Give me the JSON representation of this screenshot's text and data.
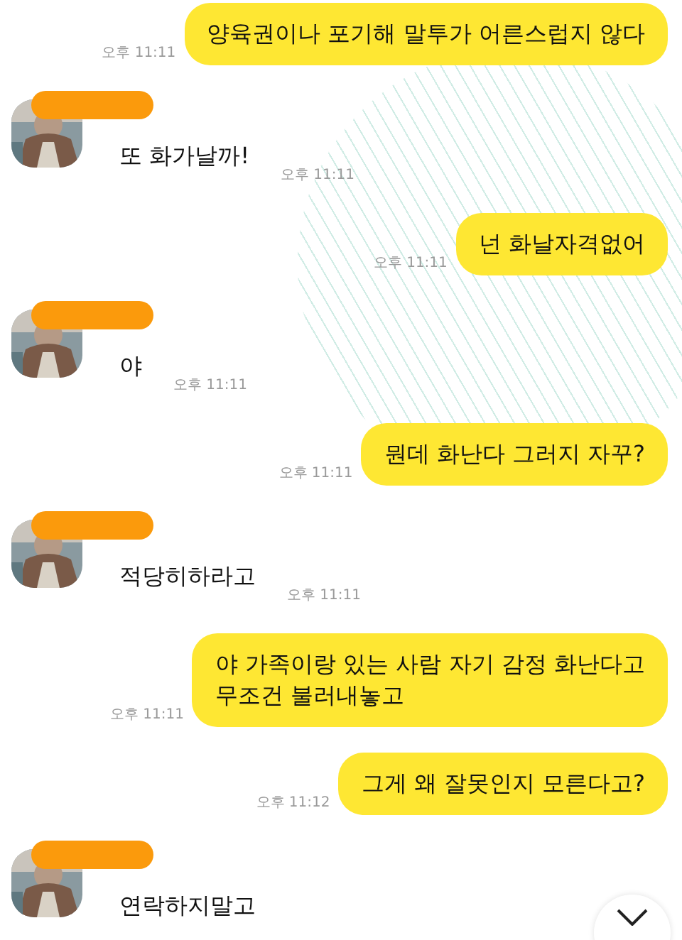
{
  "messages": [
    {
      "kind": "sent",
      "text": "양육권이나 포기해 말투가 어른스럽지 않다",
      "time": "오후 11:11"
    },
    {
      "kind": "received",
      "text": "또 화가날까!",
      "time": "오후 11:11"
    },
    {
      "kind": "sent",
      "text": "넌 화날자격없어",
      "time": "오후 11:11"
    },
    {
      "kind": "received",
      "text": "야",
      "time": "오후 11:11"
    },
    {
      "kind": "sent",
      "text": "뭔데 화난다 그러지 자꾸?",
      "time": "오후 11:11"
    },
    {
      "kind": "received",
      "text": "적당히하라고",
      "time": "오후 11:11"
    },
    {
      "kind": "sent",
      "text": "야 가족이랑 있는 사람 자기 감정 화난다고\n무조건 불러내놓고",
      "time": "오후 11:11"
    },
    {
      "kind": "sent",
      "text": "그게 왜 잘못인지 모른다고?",
      "time": "오후 11:12"
    },
    {
      "kind": "received",
      "text": "연락하지말고"
    }
  ]
}
